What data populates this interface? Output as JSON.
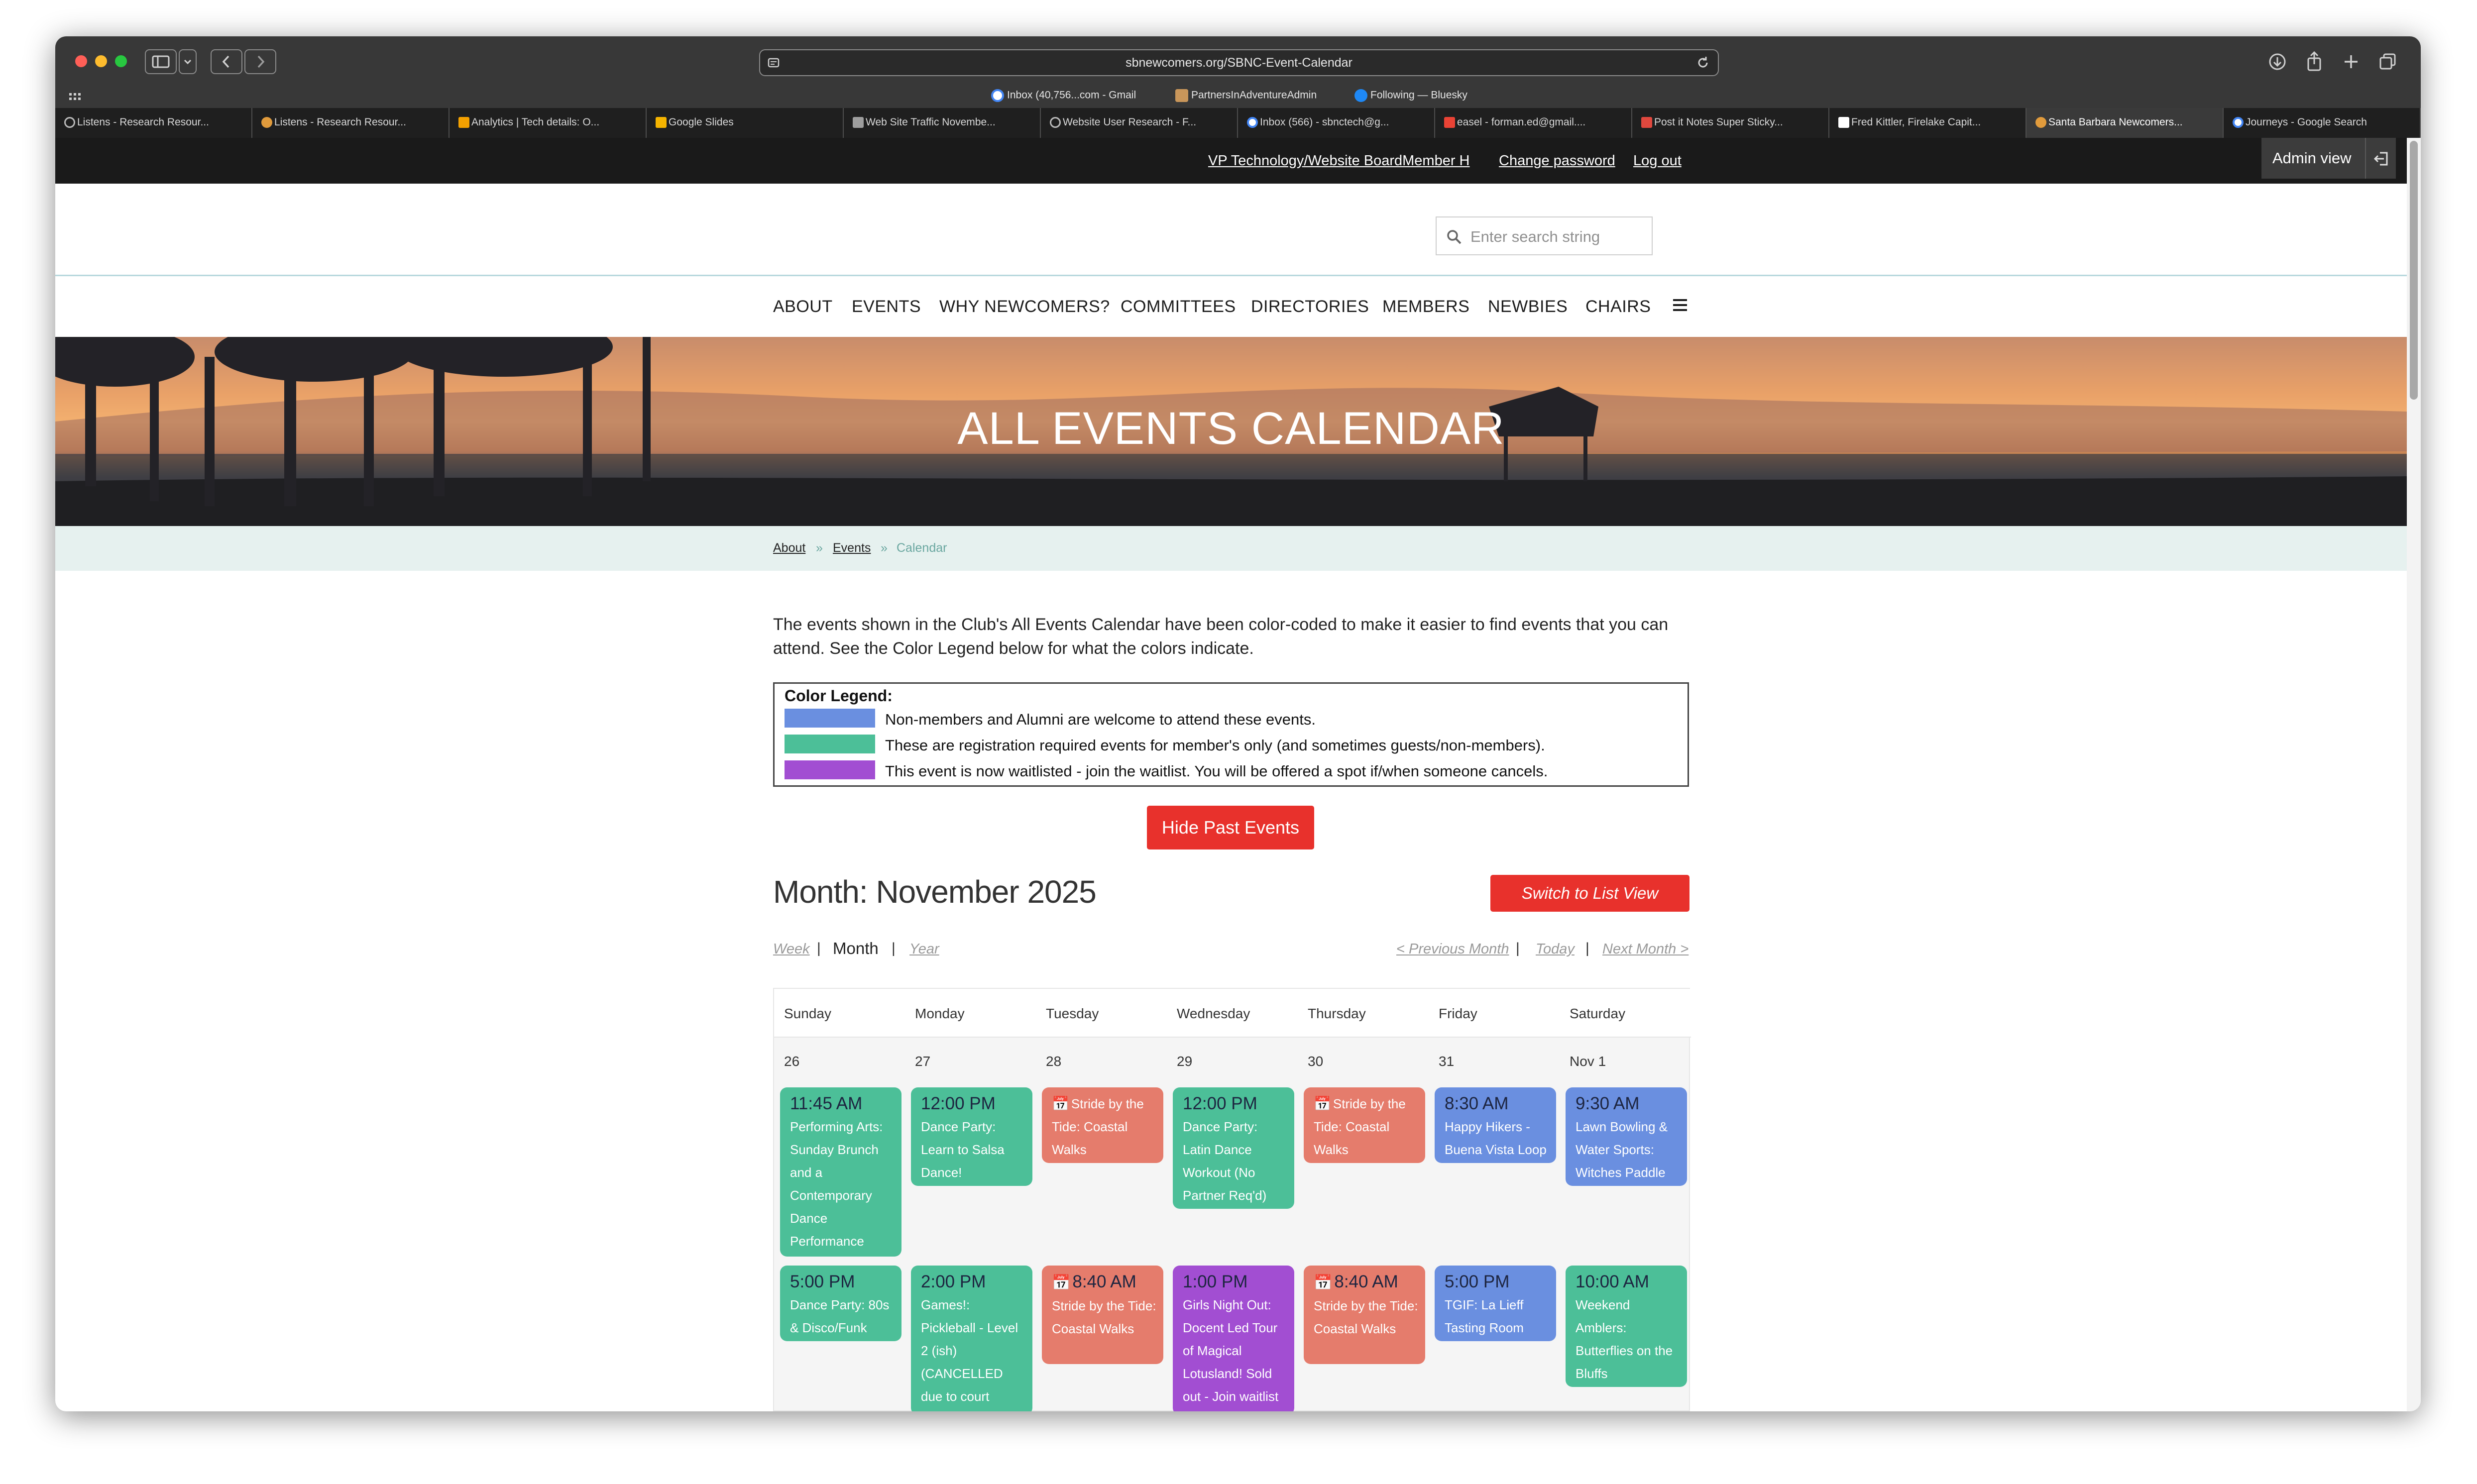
{
  "browser": {
    "url": "sbnewcomers.org/SBNC-Event-Calendar",
    "bookmarks": [
      {
        "label": "Inbox (40,756...com - Gmail",
        "icon": "google-icon"
      },
      {
        "label": "PartnersInAdventureAdmin",
        "icon": "admin-icon"
      },
      {
        "label": "Following — Bluesky",
        "icon": "butterfly-icon"
      }
    ],
    "tabs": [
      "Listens - Research Resour...",
      "Listens - Research Resour...",
      "Analytics | Tech details: O...",
      "Google Slides",
      "Web Site Traffic Novembe...",
      "Website User Research - F...",
      "Inbox (566) - sbnctech@g...",
      "easel - forman.ed@gmail....",
      "Post it Notes Super Sticky...",
      "Fred Kittler, Firelake Capit...",
      "Santa Barbara Newcomers...",
      "Journeys - Google Search"
    ]
  },
  "admin_bar": {
    "role_link": "VP Technology/Website BoardMember H",
    "change_password": "Change password",
    "logout": "Log out",
    "admin_view": "Admin view",
    "exit_icon": "exit-icon"
  },
  "header": {
    "search_placeholder": "Enter search string",
    "nav": [
      "ABOUT",
      "EVENTS",
      "WHY NEWCOMERS?",
      "COMMITTEES",
      "DIRECTORIES",
      "MEMBERS",
      "NEWBIES",
      "CHAIRS"
    ],
    "menu_icon": "hamburger-icon"
  },
  "hero": {
    "title": "ALL EVENTS CALENDAR"
  },
  "breadcrumb": {
    "items": [
      "About",
      "Events",
      "Calendar"
    ],
    "separator": "»"
  },
  "intro": "The events shown in the Club's All Events Calendar have been color-coded to make it easier to find events that you can attend. See the Color Legend below for what the colors indicate.",
  "legend": {
    "title": "Color Legend:",
    "items": [
      {
        "color": "#6a8fe0",
        "text": "Non-members and Alumni are welcome to attend these events."
      },
      {
        "color": "#4cbf98",
        "text": "These are registration required events for member's only (and sometimes guests/non-members)."
      },
      {
        "color": "#a24ed2",
        "text": "This event is now waitlisted - join the waitlist.  You will be offered a spot if/when someone cancels."
      }
    ]
  },
  "hide_past_button": "Hide Past Events",
  "calendar": {
    "month_title": "Month: November 2025",
    "list_view_button": "Switch to List View",
    "views": [
      "Week",
      "Month",
      "Year"
    ],
    "separator": "|",
    "prev": "< Previous Month",
    "today": "Today",
    "next": "Next Month >",
    "days_of_week": [
      "Sunday",
      "Monday",
      "Tuesday",
      "Wednesday",
      "Thursday",
      "Friday",
      "Saturday"
    ],
    "dates": [
      "26",
      "27",
      "28",
      "29",
      "30",
      "31",
      "Nov 1"
    ],
    "row1": [
      {
        "time": "11:45 AM",
        "title": "Performing Arts: Sunday Brunch and a Contemporary Dance Performance",
        "color": "green"
      },
      {
        "time": "12:00 PM",
        "title": "Dance Party: Learn to Salsa Dance!",
        "color": "green"
      },
      {
        "time": "",
        "title": "Stride by the Tide: Coastal Walks",
        "color": "salmon",
        "icon": "calendar-icon"
      },
      {
        "time": "12:00 PM",
        "title": "Dance Party: Latin Dance Workout (No Partner Req'd)",
        "color": "green"
      },
      {
        "time": "",
        "title": "Stride by the Tide: Coastal Walks",
        "color": "salmon",
        "icon": "calendar-icon"
      },
      {
        "time": "8:30 AM",
        "title": "Happy Hikers - Buena Vista Loop",
        "color": "blue"
      },
      {
        "time": "9:30 AM",
        "title": "Lawn Bowling & Water Sports: Witches Paddle",
        "color": "blue"
      }
    ],
    "row2": [
      {
        "time": "5:00 PM",
        "title": "Dance Party: 80s & Disco/Funk",
        "color": "green"
      },
      {
        "time": "2:00 PM",
        "title": "Games!: Pickleball - Level 2 (ish) (CANCELLED due to court",
        "color": "green"
      },
      {
        "time": "8:40 AM",
        "title": "Stride by the Tide: Coastal Walks",
        "color": "salmon",
        "icon": "calendar-icon"
      },
      {
        "time": "1:00 PM",
        "title": "Girls Night Out: Docent Led Tour of Magical Lotusland! Sold out - Join waitlist",
        "color": "purple"
      },
      {
        "time": "8:40 AM",
        "title": "Stride by the Tide: Coastal Walks",
        "color": "salmon",
        "icon": "calendar-icon"
      },
      {
        "time": "5:00 PM",
        "title": "TGIF: La Lieff Tasting Room",
        "color": "blue"
      },
      {
        "time": "10:00 AM",
        "title": "Weekend Amblers: Butterflies on the Bluffs",
        "color": "green"
      }
    ]
  }
}
